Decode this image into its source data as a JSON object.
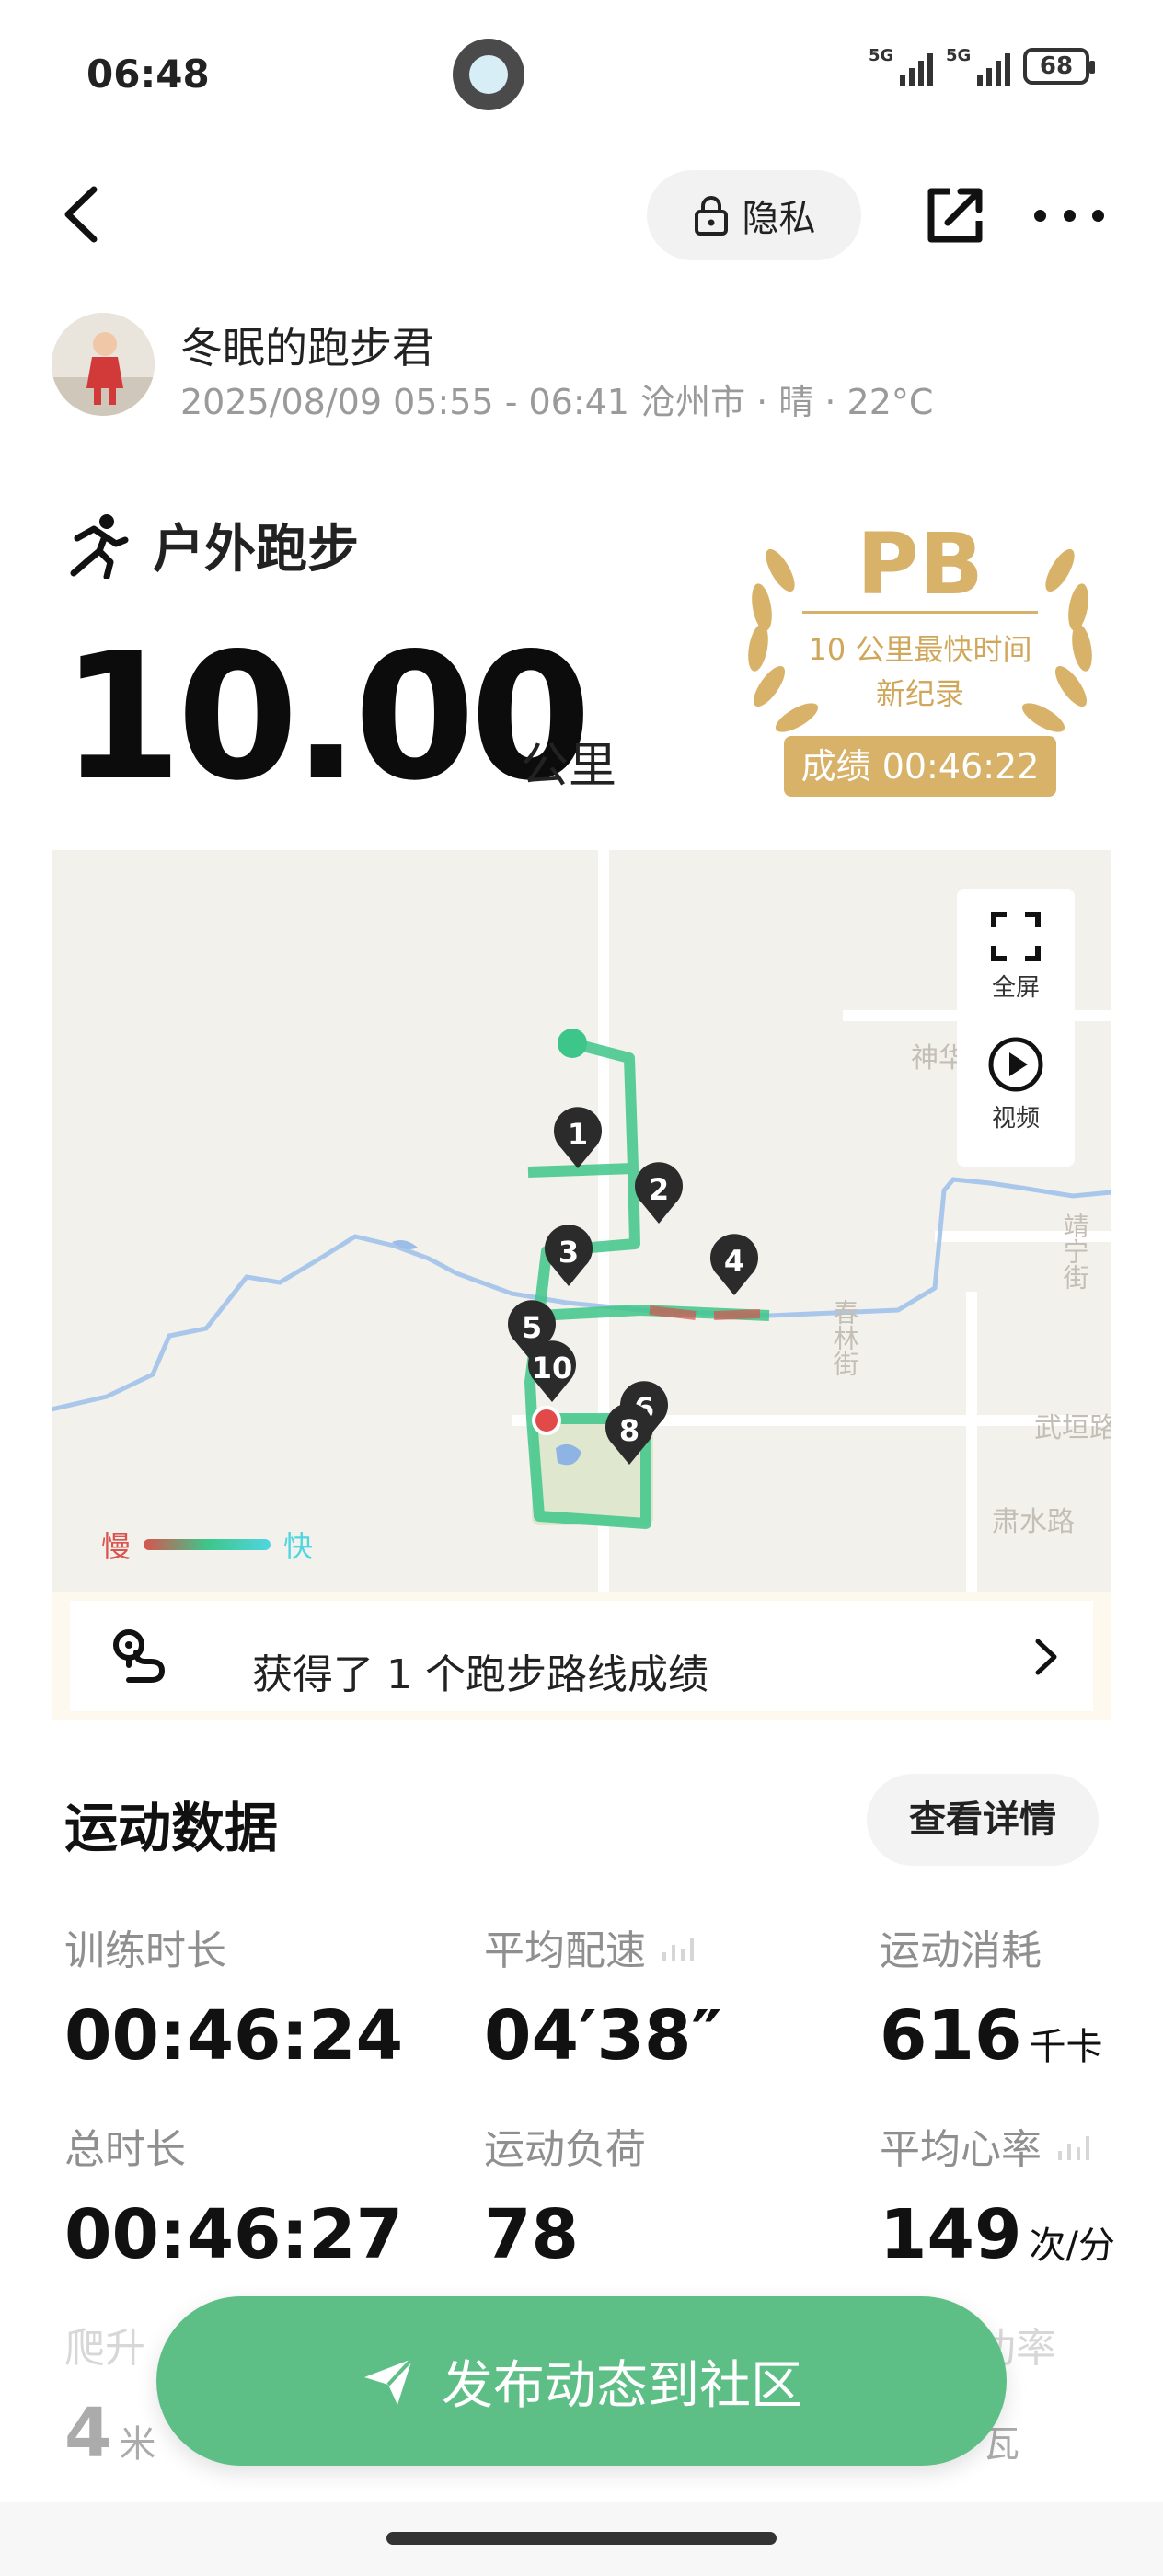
{
  "status_bar": {
    "time": "06:48",
    "signal1_label": "5G",
    "signal2_label": "5G",
    "battery": "68"
  },
  "nav": {
    "privacy_label": "隐私"
  },
  "user": {
    "name": "冬眠的跑步君",
    "meta": "2025/08/09 05:55 - 06:41 沧州市 · 晴 · 22°C"
  },
  "workout": {
    "type_label": "户外跑步",
    "distance": "10.00",
    "distance_unit": "公里"
  },
  "pb": {
    "title": "PB",
    "desc_line1": "10 公里最快时间",
    "desc_line2": "新纪录",
    "result": "成绩 00:46:22"
  },
  "map": {
    "fullscreen_label": "全屏",
    "video_label": "视频",
    "legend_slow": "慢",
    "legend_fast": "快",
    "street_labels": [
      "神华",
      "春林街",
      "靖宁街",
      "武垣路",
      "肃水路"
    ],
    "markers": [
      "1",
      "2",
      "3",
      "4",
      "5",
      "10",
      "6",
      "8"
    ],
    "route_banner": "获得了 1 个跑步路线成绩"
  },
  "stats": {
    "title": "运动数据",
    "details_label": "查看详情",
    "items": [
      {
        "label": "训练时长",
        "value": "00:46:24",
        "unit": ""
      },
      {
        "label": "平均配速",
        "value": "04′38″",
        "unit": ""
      },
      {
        "label": "运动消耗",
        "value": "616",
        "unit": "千卡"
      },
      {
        "label": "总时长",
        "value": "00:46:27",
        "unit": ""
      },
      {
        "label": "运动负荷",
        "value": "78",
        "unit": ""
      },
      {
        "label": "平均心率",
        "value": "149",
        "unit": "次/分"
      },
      {
        "label": "爬升",
        "value": "4",
        "unit": "米"
      },
      {
        "label": "功率",
        "value": "",
        "unit": "瓦"
      }
    ]
  },
  "publish": {
    "label": "发布动态到社区"
  },
  "colors": {
    "accent_green": "#5dbf85",
    "route_green": "#3ec58a",
    "pb_gold": "#d9b26a"
  }
}
